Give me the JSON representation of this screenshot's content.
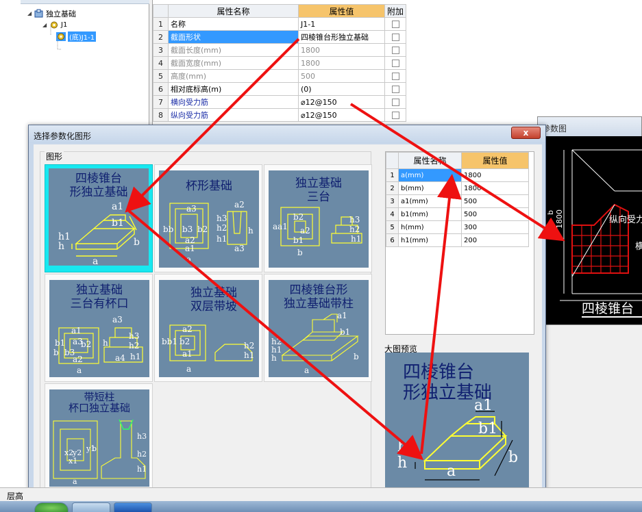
{
  "tree": {
    "root": "独立基础",
    "child": "J1",
    "leaf": "(底)J1-1"
  },
  "property_grid": {
    "col_name": "属性名称",
    "col_value": "属性值",
    "col_extra": "附加",
    "rows": [
      {
        "num": "1",
        "name": "名称",
        "value": "J1-1",
        "style": "normal"
      },
      {
        "num": "2",
        "name": "截面形状",
        "value": "四棱锥台形独立基础",
        "style": "sel"
      },
      {
        "num": "3",
        "name": "截面长度(mm)",
        "value": "1800",
        "style": "grey"
      },
      {
        "num": "4",
        "name": "截面宽度(mm)",
        "value": "1800",
        "style": "grey"
      },
      {
        "num": "5",
        "name": "高度(mm)",
        "value": "500",
        "style": "grey"
      },
      {
        "num": "6",
        "name": "相对底标高(m)",
        "value": "(0)",
        "style": "normal"
      },
      {
        "num": "7",
        "name": "横向受力筋",
        "value": "⌀12@150",
        "style": "blue"
      },
      {
        "num": "8",
        "name": "纵向受力筋",
        "value": "⌀12@150",
        "style": "blue"
      }
    ]
  },
  "param_window": {
    "title": "参数图",
    "dim_b": "b",
    "dim_1800": "1800",
    "label_rebar": "纵向受力",
    "label_h": "横",
    "caption": "四棱锥台"
  },
  "dialog": {
    "title": "选择参数化图形",
    "close": "x",
    "group_label": "图形",
    "shapes": [
      {
        "line1": "四棱锥台",
        "line2": "形独立基础"
      },
      {
        "line1": "杯形基础",
        "line2": ""
      },
      {
        "line1": "独立基础",
        "line2": "三台"
      },
      {
        "line1": "独立基础",
        "line2": "三台有杯口"
      },
      {
        "line1": "独立基础",
        "line2": "双层带坡"
      },
      {
        "line1": "四棱锥台形",
        "line2": "独立基础带柱"
      },
      {
        "line1": "带短柱",
        "line2": "杯口独立基础"
      }
    ],
    "params": {
      "col_name": "属性名称",
      "col_value": "属性值",
      "rows": [
        {
          "num": "1",
          "name": "a(mm)",
          "value": "1800"
        },
        {
          "num": "2",
          "name": "b(mm)",
          "value": "1800"
        },
        {
          "num": "3",
          "name": "a1(mm)",
          "value": "500"
        },
        {
          "num": "4",
          "name": "b1(mm)",
          "value": "500"
        },
        {
          "num": "5",
          "name": "h(mm)",
          "value": "300"
        },
        {
          "num": "6",
          "name": "h1(mm)",
          "value": "200"
        }
      ]
    },
    "preview_label": "大图预览",
    "preview_title1": "四棱锥台",
    "preview_title2": "形独立基础"
  },
  "status": {
    "floor_label": "层高"
  },
  "colors": {
    "accent_selection": "#3399ff",
    "header_value": "#f6c46b",
    "tile_bg": "#6b8aa6",
    "tile_title": "#102070",
    "drawing_line": "#ffff33",
    "arrow": "#ee1111",
    "selected_tile": "#18e8f0"
  }
}
